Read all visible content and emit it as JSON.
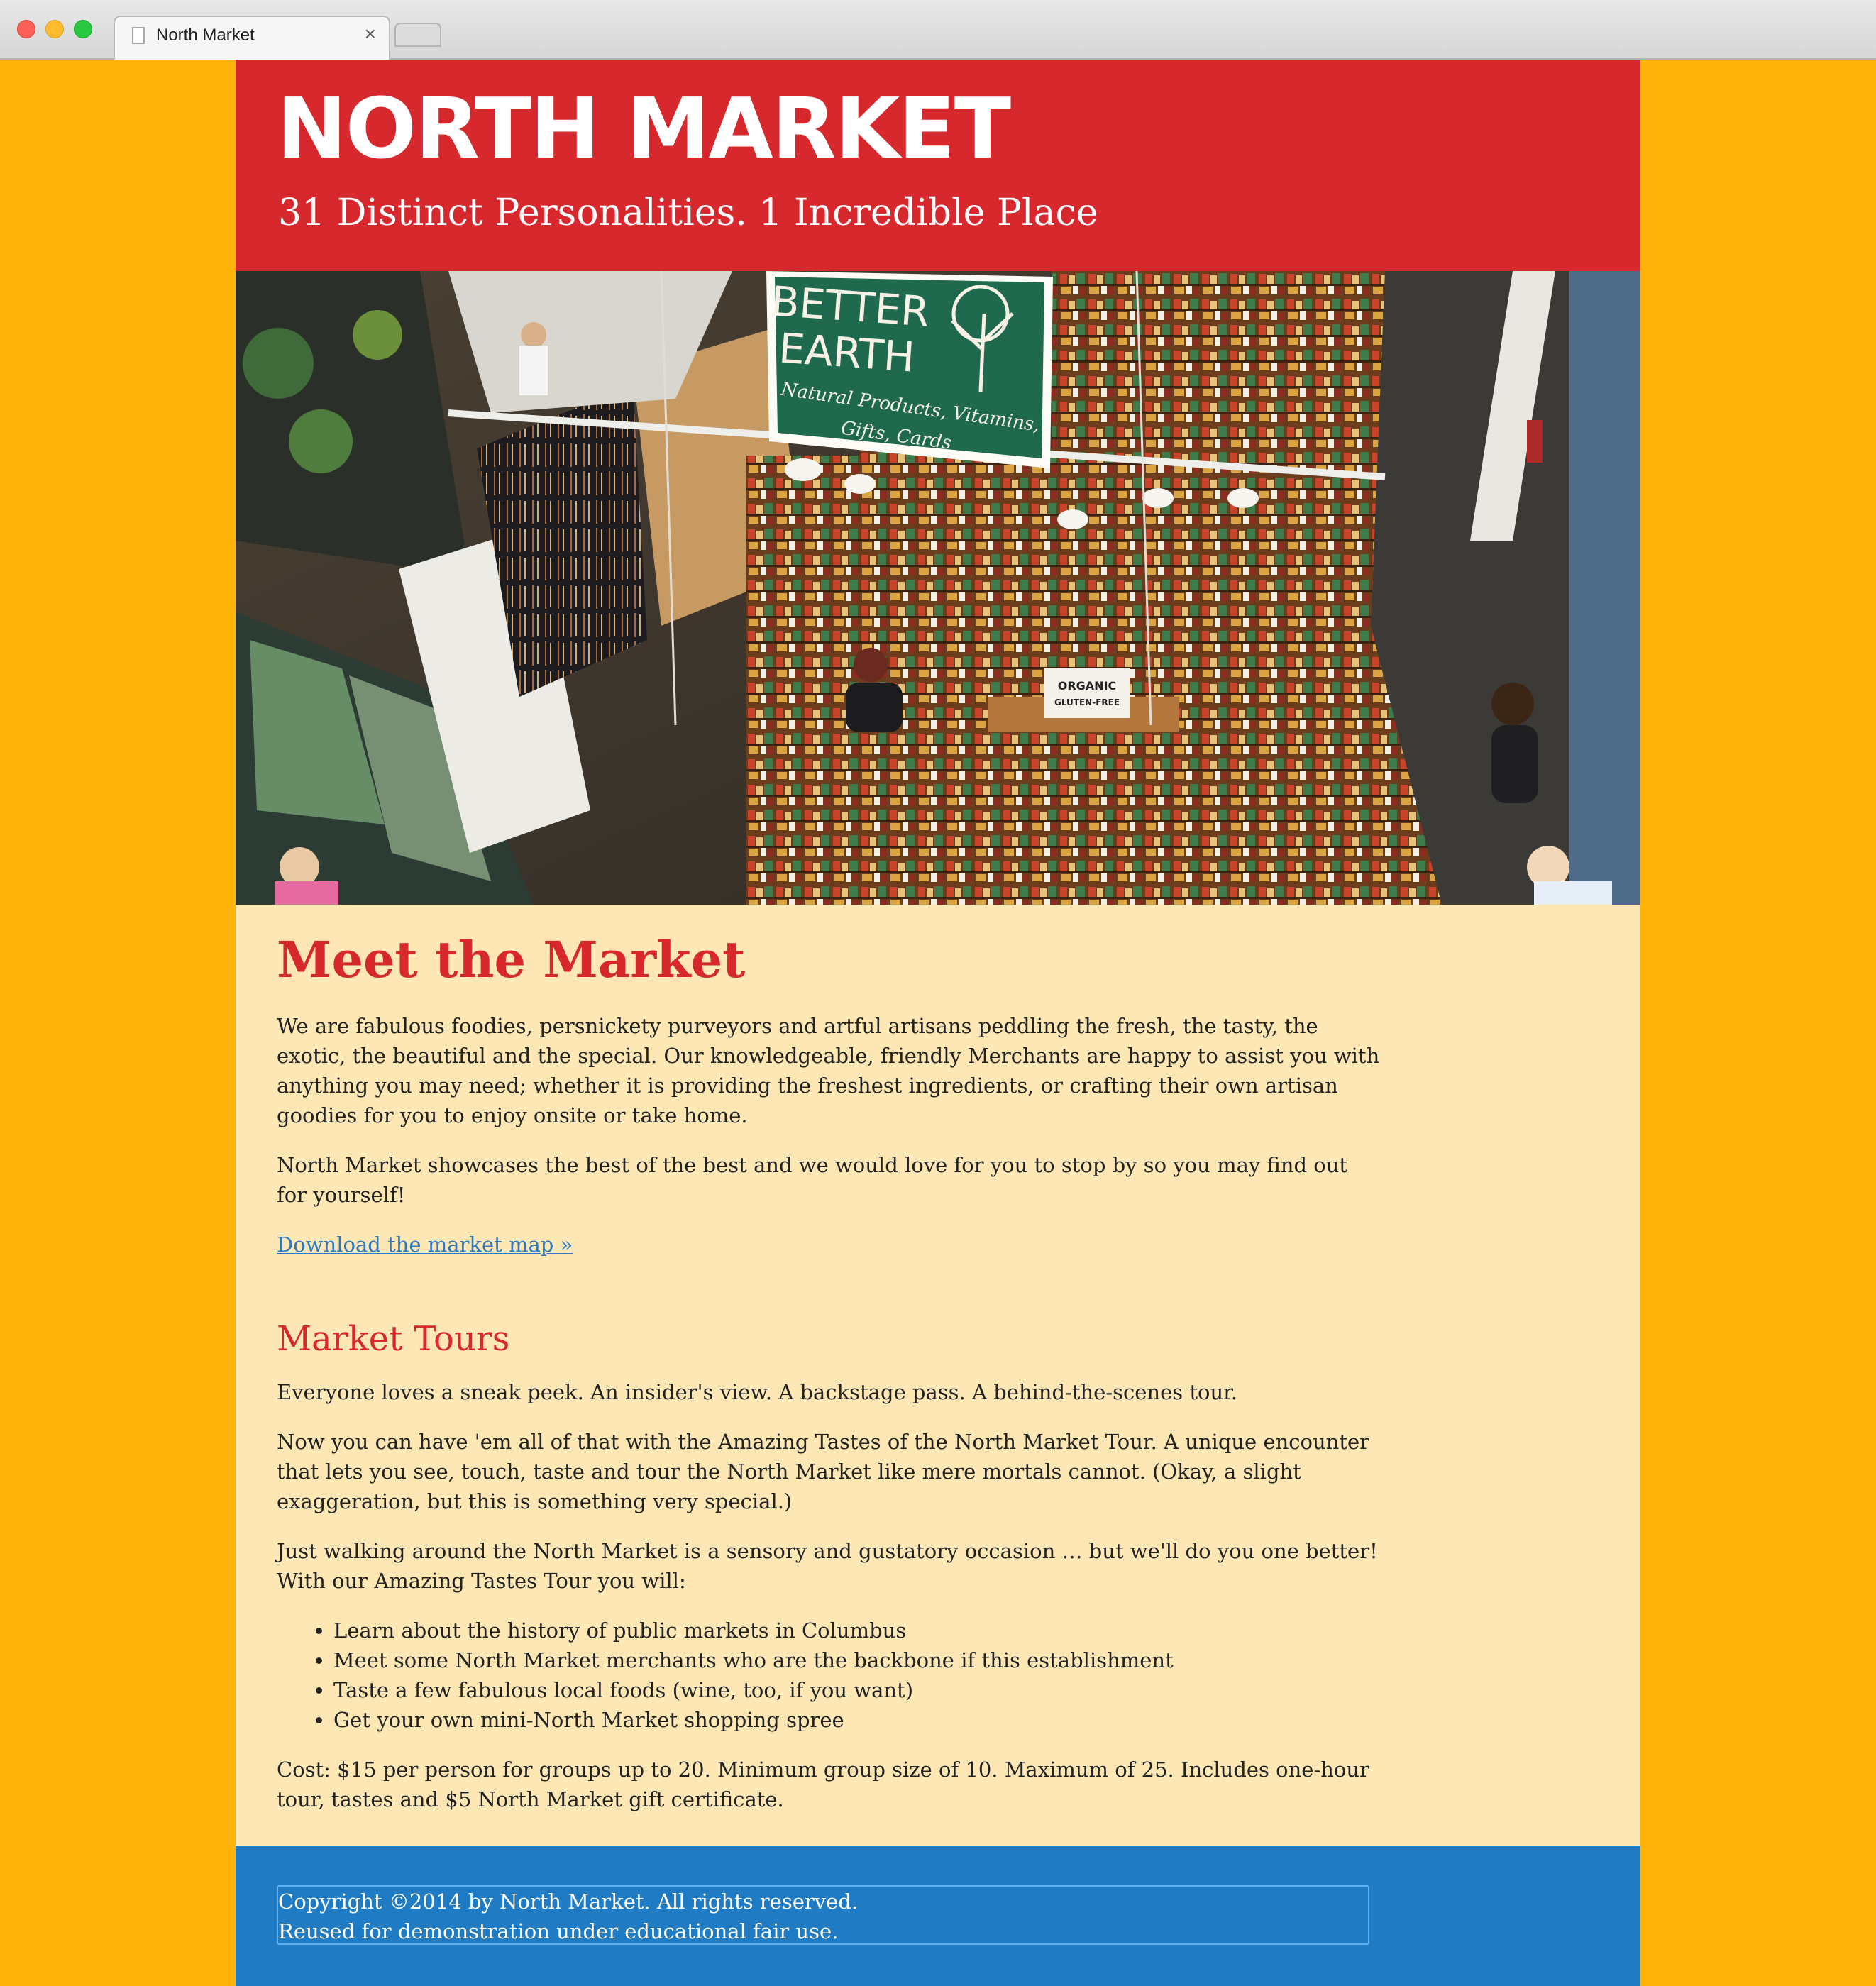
{
  "browser": {
    "tab_title": "North Market",
    "close_glyph": "×"
  },
  "header": {
    "title": "NORTH MARKET",
    "tagline": "31 Distinct Personalities. 1 Incredible Place"
  },
  "hero": {
    "sign_line1": "BETTER",
    "sign_line2": "EARTH",
    "sign_line3": "Natural Products, Vitamins,",
    "sign_line4": "Gifts, Cards",
    "box_line1": "ORGANIC",
    "box_line2": "GLUTEN-FREE"
  },
  "meet": {
    "heading": "Meet the Market",
    "paragraph1": "We are fabulous foodies, persnickety purveyors and artful artisans peddling the fresh, the tasty, the exotic, the beautiful and the special. Our knowledgeable, friendly Merchants are happy to assist you with anything you may need; whether it is providing the freshest ingredients, or crafting their own artisan goodies for you to enjoy onsite or take home.",
    "paragraph2": "North Market showcases the best of the best and we would love for you to stop by so you may find out for yourself!",
    "map_link": "Download the market map »"
  },
  "tours": {
    "heading": "Market Tours",
    "paragraph1": "Everyone loves a sneak peek. An insider's view. A backstage pass. A behind-the-scenes tour.",
    "paragraph2": "Now you can have 'em all of that with the Amazing Tastes of the North Market Tour. A unique encounter that lets you see, touch, taste and tour the North Market like mere mortals cannot. (Okay, a slight exaggeration, but this is something very special.)",
    "paragraph3": "Just walking around the North Market is a sensory and gustatory occasion … but we'll do you one better! With our Amazing Tastes Tour you will:",
    "items": [
      "Learn about the history of public markets in Columbus",
      "Meet some North Market merchants who are the backbone if this establishment",
      "Taste a few fabulous local foods (wine, too, if you want)",
      "Get your own mini-North Market shopping spree"
    ],
    "cost": "Cost: $15 per person for groups up to 20. Minimum group size of 10. Maximum of 25. Includes one-hour tour, tastes and $5 North Market gift certificate."
  },
  "footer": {
    "line1": "Copyright ©2014 by North Market. All rights reserved.",
    "line2": "Reused for demonstration under educational fair use."
  }
}
